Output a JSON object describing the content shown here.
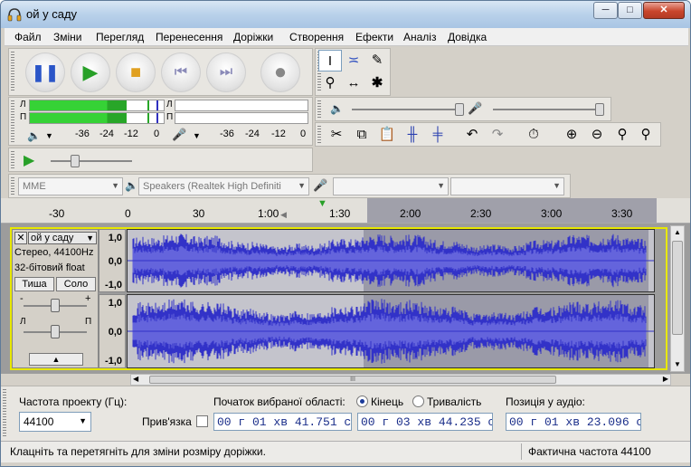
{
  "window": {
    "title": "ой у саду",
    "min": "─",
    "max": "□",
    "close": "✕"
  },
  "menu": [
    "Файл",
    "Зміни",
    "Перегляд",
    "Перенесення",
    "Доріжки",
    "Створення",
    "Ефекти",
    "Аналіз",
    "Довідка"
  ],
  "meters": {
    "play_channels": [
      "Л",
      "П"
    ],
    "rec_channels": [
      "Л",
      "П"
    ],
    "play_scale": [
      "-36",
      "-24",
      "-12",
      "0"
    ],
    "rec_scale": [
      "-36",
      "-24",
      "-12",
      "0"
    ],
    "play_level_left": 0.72,
    "play_level_right": 0.72
  },
  "devices": {
    "host": "MME",
    "output": "Speakers (Realtek High Definiti",
    "input": "",
    "channels": ""
  },
  "ruler": {
    "ticks": [
      "-30",
      "0",
      "30",
      "1:00",
      "1:30",
      "2:00",
      "2:30",
      "3:00",
      "3:30"
    ]
  },
  "track": {
    "name": "ой у саду",
    "format": "Стерео, 44100Hz",
    "bitdepth": "32-бітовий float",
    "mute": "Тиша",
    "solo": "Соло",
    "gain_minus": "-",
    "gain_plus": "+",
    "pan_left": "Л",
    "pan_right": "П",
    "amp_labels": [
      "1,0",
      "0,0",
      "-1,0"
    ],
    "selection_start_fraction": 0.448
  },
  "selbar": {
    "rate_label": "Частота проекту (Гц):",
    "rate_value": "44100",
    "snap_label": "Прив'язка",
    "start_label": "Початок вибраної області:",
    "end_label": "Кінець",
    "length_label": "Тривалість",
    "pos_label": "Позиція у аудіо:",
    "start_time": "00 г 01 хв 41.751 с",
    "end_time": "00 г 03 хв 44.235 с",
    "pos_time": "00 г 01 хв 23.096 с"
  },
  "status": {
    "hint": "Клацніть та перетягніть для зміни розміру доріжки.",
    "rate": "Фактична частота 44100"
  },
  "hscroll": {
    "grip": "III"
  },
  "colors": {
    "wave": "#3232c8",
    "wave_light": "#6464dc",
    "meter_green": "#36d236",
    "meter_dark": "#28a628",
    "selection": "#9a9aa8"
  }
}
